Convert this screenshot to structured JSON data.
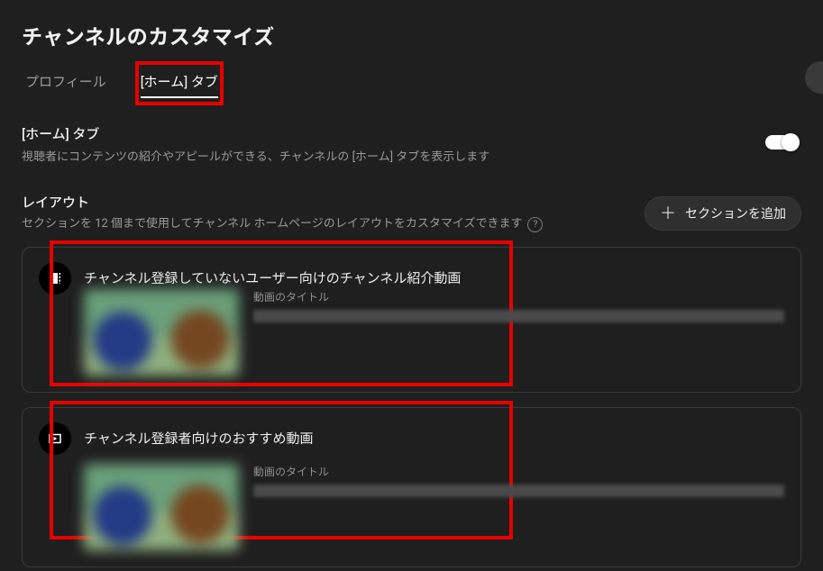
{
  "header": {
    "title": "チャンネルのカスタマイズ"
  },
  "tabs": {
    "profile": "プロフィール",
    "home_tab": "[ホーム] タブ"
  },
  "home_tab_section": {
    "heading": "[ホーム] タブ",
    "description": "視聴者にコンテンツの紹介やアピールができる、チャンネルの [ホーム] タブを表示します"
  },
  "layout_section": {
    "heading": "レイアウト",
    "description": "セクションを 12 個まで使用してチャンネル ホームページのレイアウトをカスタマイズできます",
    "add_button": "セクションを追加"
  },
  "cards": [
    {
      "title": "チャンネル登録していないユーザー向けのチャンネル紹介動画",
      "meta_label": "動画のタイトル"
    },
    {
      "title": "チャンネル登録者向けのおすすめ動画",
      "meta_label": "動画のタイトル"
    }
  ]
}
